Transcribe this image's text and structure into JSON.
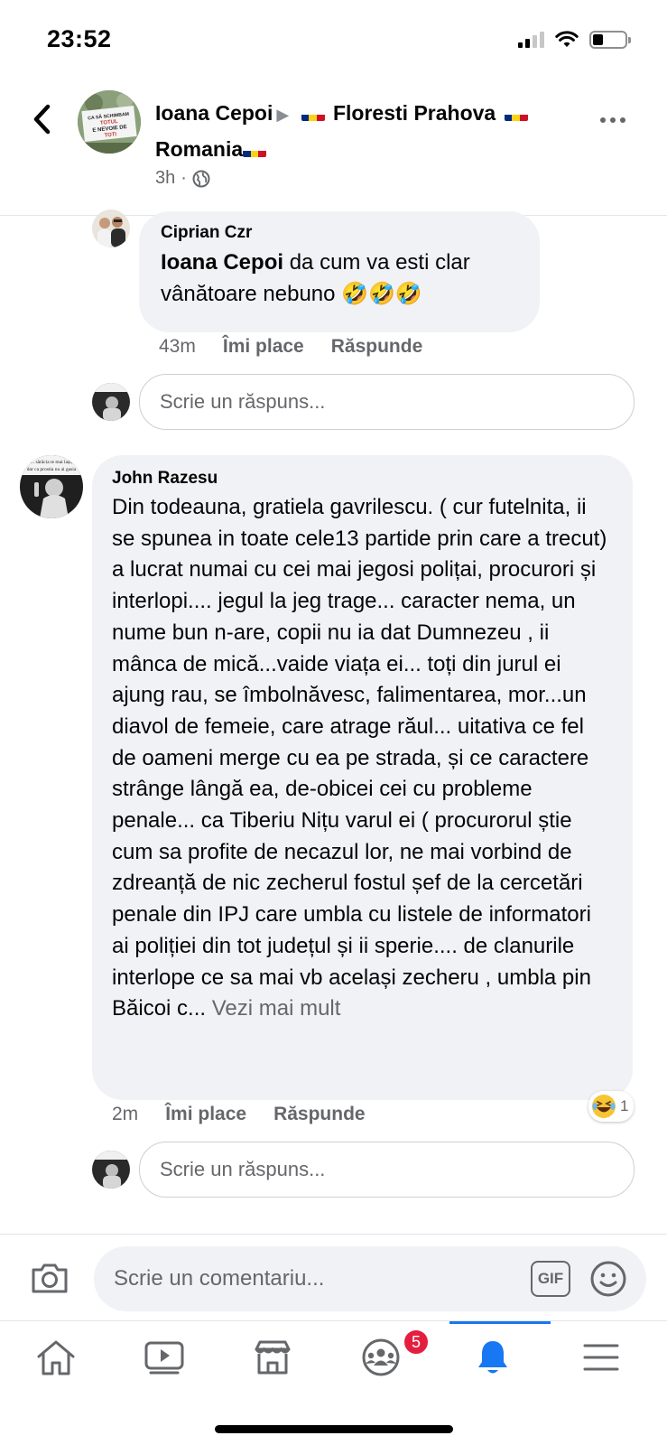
{
  "status_bar": {
    "time": "23:52",
    "signal_icon": "cellular-signal-icon",
    "wifi_icon": "wifi-icon",
    "battery_icon": "battery-icon",
    "battery_level": 0.3
  },
  "post_header": {
    "back_icon": "chevron-left-icon",
    "author": "Ioana Cepoi",
    "group_line_1": "Floresti Prahova",
    "group_line_2": "Romania",
    "avatar_sign_text": [
      "CA SĂ SCHIMBAM",
      "TOTUL",
      "E NEVOIE DE",
      "TOTI"
    ],
    "time": "3h",
    "separator": "·",
    "audience_icon": "globe-icon",
    "more_icon": "more-horizontal-icon",
    "flag_colors": [
      "#002b7f",
      "#fcd116",
      "#ce1126"
    ]
  },
  "comments": [
    {
      "author": "Ciprian Czr",
      "mention": "Ioana Cepoi",
      "text": " da cum va esti clar vânătoare nebuno 🤣🤣🤣",
      "time": "43m",
      "like_label": "Îmi place",
      "reply_label": "Răspunde",
      "reply_placeholder": "Scrie un răspuns..."
    },
    {
      "author": "John Razesu",
      "avatar_caption": [
        "... sărăcia te mai lași,",
        "dar ca prostia nu ai gasia"
      ],
      "text": "Din todeauna, gratiela gavrilescu. ( cur futelnita, ii se spunea in toate cele13 partide prin care a trecut) a lucrat numai cu cei mai jegosi polițai, procurori și interlopi.... jegul la jeg trage... caracter nema, un nume bun n-are, copii nu ia dat Dumnezeu , ii mânca de mică...vaide viața ei... toți din jurul ei ajung rau, se îmbolnăvesc, falimentarea, mor...un diavol de femeie, care atrage răul... uitativa ce fel de oameni merge cu ea pe strada, și ce caractere strânge lângă ea, de-obicei cei cu probleme penale... ca Tiberiu Nițu varul ei ( procurorul știe cum sa profite de necazul lor, ne mai vorbind de zdreanță de nic zecherul fostul șef de la cercetări penale din IPJ care umbla cu listele de informatori ai poliției din tot județul și ii sperie.... de clanurile interlope ce sa mai vb același zecheru , umbla pin Băicoi c...",
      "see_more": "Vezi mai mult",
      "time": "2m",
      "like_label": "Îmi place",
      "reply_label": "Răspunde",
      "reaction_icon": "laughing-emoji-icon",
      "reaction_count": "1",
      "reply_placeholder": "Scrie un răspuns..."
    }
  ],
  "composer": {
    "camera_icon": "camera-icon",
    "placeholder": "Scrie un comentariu...",
    "gif_label": "GIF",
    "emoji_icon": "smiley-icon"
  },
  "tab_bar": {
    "tabs": [
      {
        "name": "home",
        "icon": "home-icon"
      },
      {
        "name": "watch",
        "icon": "video-icon"
      },
      {
        "name": "marketplace",
        "icon": "marketplace-icon"
      },
      {
        "name": "groups",
        "icon": "groups-icon",
        "badge": "5"
      },
      {
        "name": "notifications",
        "icon": "bell-icon",
        "active": true
      },
      {
        "name": "menu",
        "icon": "hamburger-menu-icon"
      }
    ],
    "accent_color": "#1877f2",
    "badge_color": "#e41e3f"
  }
}
